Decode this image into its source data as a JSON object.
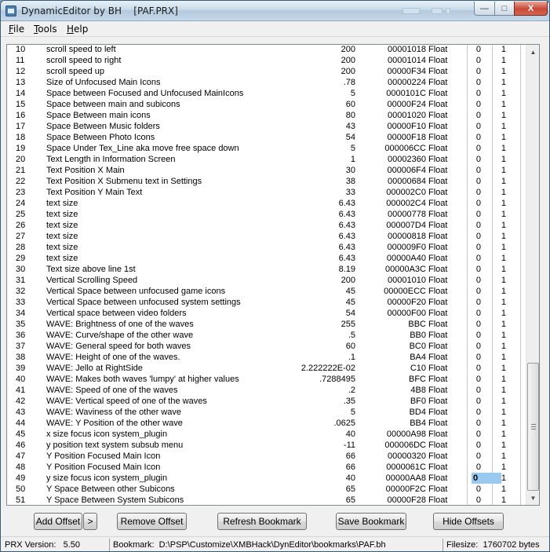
{
  "window": {
    "title": "DynamicEditor by BH    [PAF.PRX]",
    "controls": {
      "minimize": "—",
      "maximize": "□",
      "close": "X"
    }
  },
  "menu": {
    "file": "File",
    "tools": "Tools",
    "help": "Help"
  },
  "table": {
    "rows": [
      {
        "idx": "10",
        "name": "scroll speed to left",
        "value": "200",
        "offset": "00001018",
        "type": "Float",
        "z": "0",
        "o": "1"
      },
      {
        "idx": "11",
        "name": "scroll speed to right",
        "value": "200",
        "offset": "00001014",
        "type": "Float",
        "z": "0",
        "o": "1"
      },
      {
        "idx": "12",
        "name": "scroll speed up",
        "value": "200",
        "offset": "00000F34",
        "type": "Float",
        "z": "0",
        "o": "1"
      },
      {
        "idx": "13",
        "name": "Size of Unfocused Main Icons",
        "value": ".78",
        "offset": "00000224",
        "type": "Float",
        "z": "0",
        "o": "1"
      },
      {
        "idx": "14",
        "name": "Space between Focused and Unfocused MainIcons",
        "value": "5",
        "offset": "0000101C",
        "type": "Float",
        "z": "0",
        "o": "1"
      },
      {
        "idx": "15",
        "name": "Space between main and subicons",
        "value": "60",
        "offset": "00000F24",
        "type": "Float",
        "z": "0",
        "o": "1"
      },
      {
        "idx": "16",
        "name": "Space Between main icons",
        "value": "80",
        "offset": "00001020",
        "type": "Float",
        "z": "0",
        "o": "1"
      },
      {
        "idx": "17",
        "name": "Space Between Music folders",
        "value": "43",
        "offset": "00000F10",
        "type": "Float",
        "z": "0",
        "o": "1"
      },
      {
        "idx": "18",
        "name": "Space Between Photo Icons",
        "value": "54",
        "offset": "00000F18",
        "type": "Float",
        "z": "0",
        "o": "1"
      },
      {
        "idx": "19",
        "name": "Space Under Tex_Line aka move free space down",
        "value": "5",
        "offset": "000006CC",
        "type": "Float",
        "z": "0",
        "o": "1"
      },
      {
        "idx": "20",
        "name": "Text Length in Information Screen",
        "value": "1",
        "offset": "00002360",
        "type": "Float",
        "z": "0",
        "o": "1"
      },
      {
        "idx": "21",
        "name": "Text Position X Main",
        "value": "30",
        "offset": "000006F4",
        "type": "Float",
        "z": "0",
        "o": "1"
      },
      {
        "idx": "22",
        "name": "Text Position X Submenu text in Settings",
        "value": "38",
        "offset": "00000684",
        "type": "Float",
        "z": "0",
        "o": "1"
      },
      {
        "idx": "23",
        "name": "Text Position Y Main Text",
        "value": "33",
        "offset": "000002C0",
        "type": "Float",
        "z": "0",
        "o": "1"
      },
      {
        "idx": "24",
        "name": "text size",
        "value": "6.43",
        "offset": "000002C4",
        "type": "Float",
        "z": "0",
        "o": "1"
      },
      {
        "idx": "25",
        "name": "text size",
        "value": "6.43",
        "offset": "00000778",
        "type": "Float",
        "z": "0",
        "o": "1"
      },
      {
        "idx": "26",
        "name": "text size",
        "value": "6.43",
        "offset": "000007D4",
        "type": "Float",
        "z": "0",
        "o": "1"
      },
      {
        "idx": "27",
        "name": "text size",
        "value": "6.43",
        "offset": "00000818",
        "type": "Float",
        "z": "0",
        "o": "1"
      },
      {
        "idx": "28",
        "name": "text size",
        "value": "6.43",
        "offset": "000009F0",
        "type": "Float",
        "z": "0",
        "o": "1"
      },
      {
        "idx": "29",
        "name": "text size",
        "value": "6.43",
        "offset": "00000A40",
        "type": "Float",
        "z": "0",
        "o": "1"
      },
      {
        "idx": "30",
        "name": "Text size above line 1st",
        "value": "8.19",
        "offset": "00000A3C",
        "type": "Float",
        "z": "0",
        "o": "1"
      },
      {
        "idx": "31",
        "name": "Vertical Scrolling Speed",
        "value": "200",
        "offset": "00001010",
        "type": "Float",
        "z": "0",
        "o": "1"
      },
      {
        "idx": "32",
        "name": "Vertical Space between unfocused game icons",
        "value": "45",
        "offset": "00000ECC",
        "type": "Float",
        "z": "0",
        "o": "1"
      },
      {
        "idx": "33",
        "name": "Vertical Space between unfocused system settings",
        "value": "45",
        "offset": "00000F20",
        "type": "Float",
        "z": "0",
        "o": "1"
      },
      {
        "idx": "34",
        "name": "Vertical space between video folders",
        "value": "54",
        "offset": "00000F00",
        "type": "Float",
        "z": "0",
        "o": "1"
      },
      {
        "idx": "35",
        "name": "WAVE: Brightness of one of the waves",
        "value": "255",
        "offset": "BBC",
        "type": "Float",
        "z": "0",
        "o": "1"
      },
      {
        "idx": "36",
        "name": "WAVE: Curve/shape of the other wave",
        "value": ".5",
        "offset": "BB0",
        "type": "Float",
        "z": "0",
        "o": "1"
      },
      {
        "idx": "37",
        "name": "WAVE: General speed for both waves",
        "value": "60",
        "offset": "BC0",
        "type": "Float",
        "z": "0",
        "o": "1"
      },
      {
        "idx": "38",
        "name": "WAVE: Height of one of the waves.",
        "value": ".1",
        "offset": "BA4",
        "type": "Float",
        "z": "0",
        "o": "1"
      },
      {
        "idx": "39",
        "name": "WAVE: Jello at RightSide",
        "value": "2.222222E-02",
        "offset": "C10",
        "type": "Float",
        "z": "0",
        "o": "1"
      },
      {
        "idx": "40",
        "name": "WAVE: Makes both waves 'lumpy' at higher values",
        "value": ".7288495",
        "offset": "BFC",
        "type": "Float",
        "z": "0",
        "o": "1"
      },
      {
        "idx": "41",
        "name": "WAVE: Speed of one of the waves",
        "value": ".2",
        "offset": "4B8",
        "type": "Float",
        "z": "0",
        "o": "1"
      },
      {
        "idx": "42",
        "name": "WAVE: Vertical speed of one of the waves",
        "value": ".35",
        "offset": "BF0",
        "type": "Float",
        "z": "0",
        "o": "1"
      },
      {
        "idx": "43",
        "name": "WAVE: Waviness of the other wave",
        "value": "5",
        "offset": "BD4",
        "type": "Float",
        "z": "0",
        "o": "1"
      },
      {
        "idx": "44",
        "name": "WAVE: Y Position of the other wave",
        "value": ".0625",
        "offset": "BB4",
        "type": "Float",
        "z": "0",
        "o": "1"
      },
      {
        "idx": "45",
        "name": "x size focus icon system_plugin",
        "value": "40",
        "offset": "00000A98",
        "type": "Float",
        "z": "0",
        "o": "1"
      },
      {
        "idx": "46",
        "name": "y position  text system subsub menu",
        "value": "-11",
        "offset": "000006DC",
        "type": "Float",
        "z": "0",
        "o": "1"
      },
      {
        "idx": "47",
        "name": "Y Position Focused Main Icon",
        "value": "66",
        "offset": "00000320",
        "type": "Float",
        "z": "0",
        "o": "1"
      },
      {
        "idx": "48",
        "name": "Y Position Focused Main Icon",
        "value": "66",
        "offset": "0000061C",
        "type": "Float",
        "z": "0",
        "o": "1"
      },
      {
        "idx": "49",
        "name": "y size focus icon system_plugin",
        "value": "40",
        "offset": "00000AA8",
        "type": "Float",
        "z": "0",
        "o": "1",
        "selected": true
      },
      {
        "idx": "50",
        "name": "Y Space Between other Subicons",
        "value": "65",
        "offset": "00000F2C",
        "type": "Float",
        "z": "0",
        "o": "1"
      },
      {
        "idx": "51",
        "name": "Y Space Between System Subicons",
        "value": "65",
        "offset": "00000F28",
        "type": "Float",
        "z": "0",
        "o": "1"
      }
    ]
  },
  "buttons": {
    "add_offset": "Add Offset",
    "add_more": ">",
    "remove_offset": "Remove Offset",
    "refresh_bookmark": "Refresh Bookmark",
    "save_bookmark": "Save Bookmark",
    "hide_offsets": "Hide Offsets"
  },
  "status": {
    "prx_version": "PRX Version:   5.50",
    "bookmark": "Bookmark:  D:\\PSP\\Customize\\XMBHack\\DynEditor\\bookmarks\\PAF.bh",
    "filesize": "Filesize:  1760702 bytes"
  }
}
